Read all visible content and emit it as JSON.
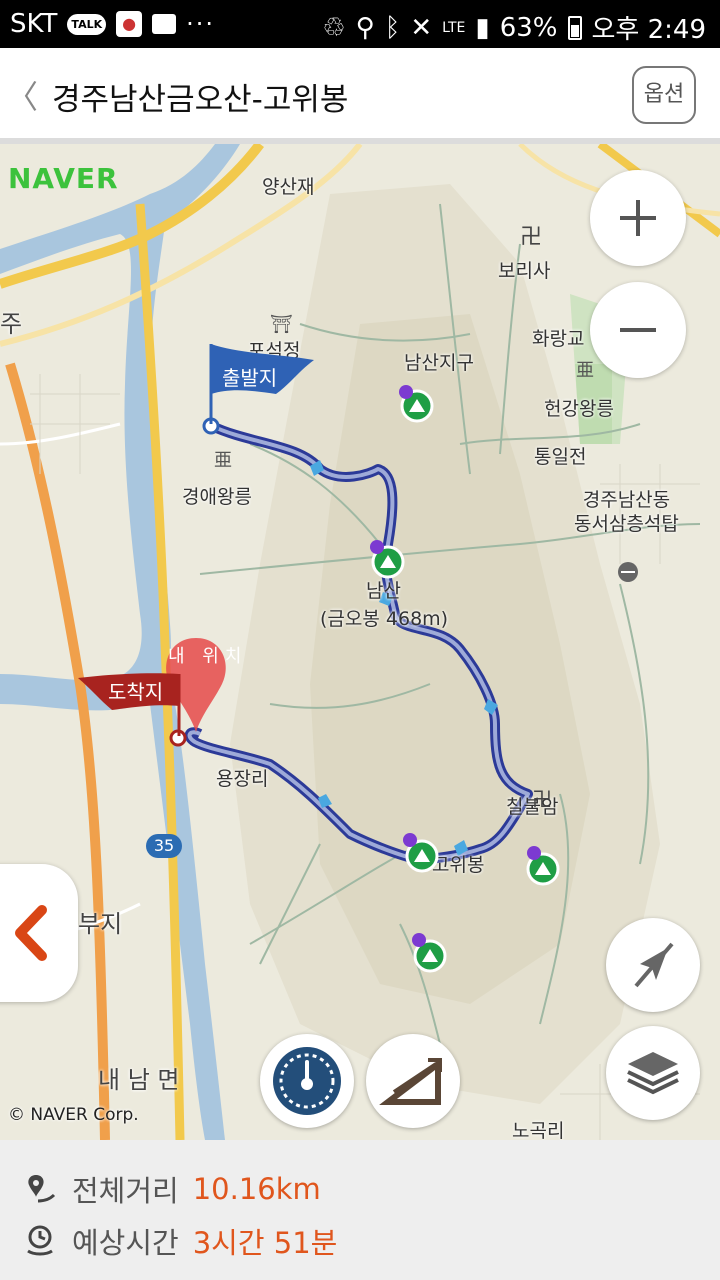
{
  "status": {
    "carrier": "SKT",
    "talk": "TALK",
    "overflow": "···",
    "network": "LTE",
    "battery": "63%",
    "time": "오후 2:49"
  },
  "header": {
    "back": "〈",
    "title": "경주남산금오산-고위봉",
    "option_label": "옵션"
  },
  "map": {
    "brand": "NAVER",
    "copyright": "© NAVER Corp.",
    "labels": {
      "yangsanjae": "양산재",
      "borisa": "보리사",
      "joo": "주",
      "poseokjeong": "포석정",
      "namsanjigu": "남산지구",
      "hwarang": "화랑교",
      "heongang": "헌강왕릉",
      "tongiljeon": "통일전",
      "gyeongae": "경애왕릉",
      "pagoda": "경주남산동\n동서삼층석탑",
      "geumobong": "(금오봉 468m)",
      "geumobong_top": "남산",
      "yongjang": "용장리",
      "chilbulam": "칠불암",
      "gowibong": "고위봉",
      "buji": "부지",
      "naenam": "내 남 면",
      "nogokri": "노곡리",
      "route35": "35"
    },
    "markers": {
      "start": "출발지",
      "end": "도착지",
      "mylocation": "내 위치"
    }
  },
  "icons": {
    "zoom_in": "plus-icon",
    "zoom_out": "minus-icon",
    "collapse": "chevron-left-icon",
    "speed": "speedometer-icon",
    "elevation": "elevation-icon",
    "location_off": "location-off-icon",
    "layers": "layers-icon"
  },
  "summary": {
    "distance_label": "전체거리",
    "distance_value": "10.16km",
    "time_label": "예상시간",
    "time_value": "3시간 51분"
  },
  "colors": {
    "route": "#3b4aa8",
    "accent": "#e0561d",
    "flag_start": "#2f62b5",
    "flag_end": "#a8231f",
    "naver_green": "#3cc23c"
  }
}
